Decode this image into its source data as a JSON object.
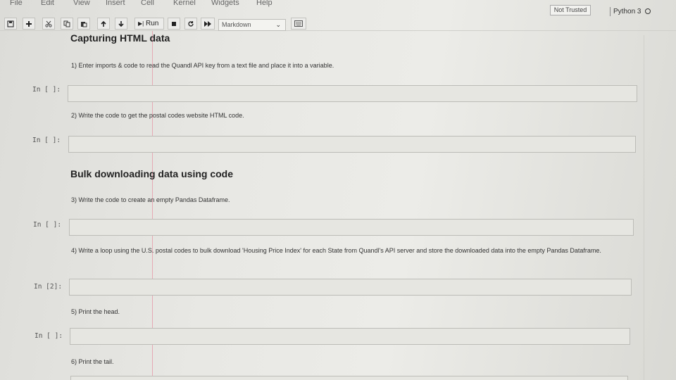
{
  "menu": [
    "File",
    "Edit",
    "View",
    "Insert",
    "Cell",
    "Kernel",
    "Widgets",
    "Help"
  ],
  "status": {
    "trusted": "Not Trusted",
    "kernel": "Python 3"
  },
  "toolbar": {
    "run_label": "Run",
    "cell_type": "Markdown",
    "icons": [
      "save-icon",
      "plus-icon",
      "cut-icon",
      "copy-icon",
      "paste-icon",
      "arrow-up-icon",
      "arrow-down-icon",
      "run-icon",
      "stop-icon",
      "restart-icon",
      "fast-forward-icon",
      "keyboard-icon"
    ]
  },
  "notebook": {
    "heading1": "Capturing HTML data",
    "heading2": "Bulk downloading data using code",
    "steps": [
      "1) Enter imports & code to read the Quandl API key from a text file and place it into a variable.",
      "2) Write the code to get the postal codes website HTML code.",
      "3) Write the code to create an empty Pandas Dataframe.",
      "4) Write a loop using the U.S. postal codes to bulk download 'Housing Price Index' for each State from Quandl's API server and store the downloaded data into the empty Pandas Dataframe.",
      "5) Print the head.",
      "6) Print the tail."
    ],
    "prompts": [
      "In [ ]:",
      "In [ ]:",
      "In [ ]:",
      "In [2]:",
      "In [ ]:"
    ]
  }
}
